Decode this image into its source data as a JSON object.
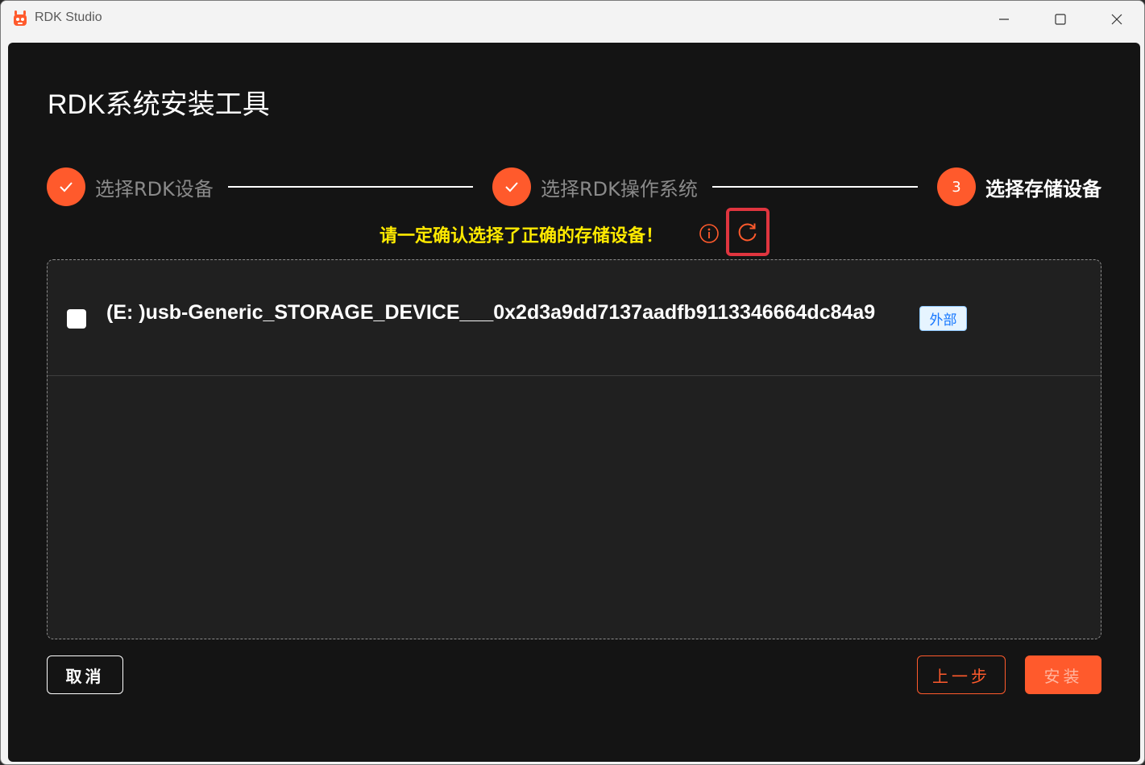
{
  "window": {
    "title": "RDK Studio",
    "minimize_icon": "minimize-icon",
    "maximize_icon": "maximize-icon",
    "close_icon": "close-icon"
  },
  "page": {
    "title": "RDK系统安装工具"
  },
  "steps": [
    {
      "index": "1",
      "label": "选择RDK设备",
      "status": "completed",
      "icon": "check-icon"
    },
    {
      "index": "2",
      "label": "选择RDK操作系统",
      "status": "completed",
      "icon": "check-icon"
    },
    {
      "index": "3",
      "label": "选择存储设备",
      "status": "active"
    }
  ],
  "warning": {
    "text": "请一定确认选择了正确的存储设备！",
    "info_icon": "info-icon",
    "refresh_icon": "refresh-icon"
  },
  "devices": [
    {
      "name": "(E: )usb-Generic_STORAGE_DEVICE___0x2d3a9dd7137aadfb9113346664dc84a9",
      "tag": "外部",
      "checked": false
    }
  ],
  "buttons": {
    "cancel": "取消",
    "prev": "上一步",
    "install": "安装"
  },
  "colors": {
    "accent": "#ff5a2c",
    "warning": "#ffea00",
    "highlight_border": "#e0353f",
    "background": "#141414",
    "panel": "#202020"
  }
}
